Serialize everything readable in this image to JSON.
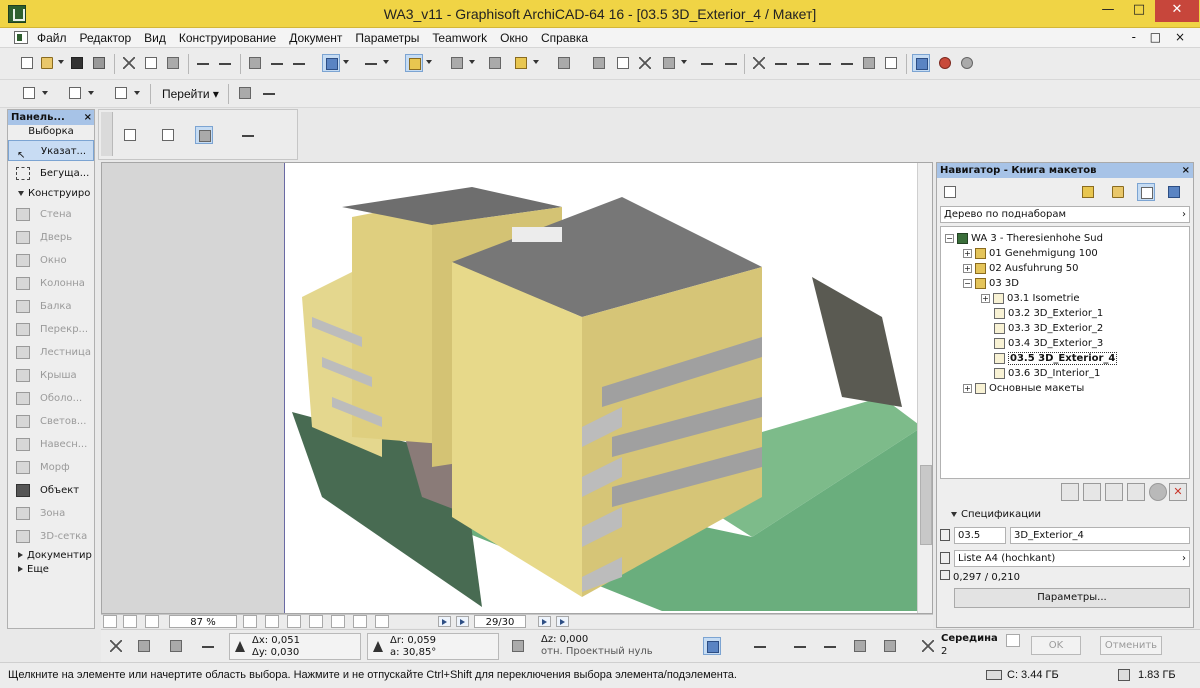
{
  "title": "WA3_v11 - Graphisoft ArchiCAD-64 16 - [03.5 3D_Exterior_4 / Макет]",
  "window_controls": {
    "minimize": "—",
    "maximize": "□",
    "close": "✕"
  },
  "doc_controls": "- □ ×",
  "menu": [
    "Файл",
    "Редактор",
    "Вид",
    "Конструирование",
    "Документ",
    "Параметры",
    "Teamwork",
    "Окно",
    "Справка"
  ],
  "toolbar": {
    "goto_label": "Перейти"
  },
  "left_panel": {
    "header": "Панель...",
    "close": "×",
    "select_title": "Выборка",
    "select_tools": [
      {
        "label": "Указат...",
        "icon": "arrow-pointer-icon",
        "active": true
      },
      {
        "label": "Бегуща...",
        "icon": "marquee-icon",
        "active": false
      }
    ],
    "design_title": "Конструиро",
    "design_tools": [
      {
        "label": "Стена",
        "icon": "wall-icon",
        "dim": true
      },
      {
        "label": "Дверь",
        "icon": "door-icon",
        "dim": true
      },
      {
        "label": "Окно",
        "icon": "window-icon",
        "dim": true
      },
      {
        "label": "Колонна",
        "icon": "column-icon",
        "dim": true
      },
      {
        "label": "Балка",
        "icon": "beam-icon",
        "dim": true
      },
      {
        "label": "Перекр...",
        "icon": "slab-icon",
        "dim": true
      },
      {
        "label": "Лестница",
        "icon": "stair-icon",
        "dim": true
      },
      {
        "label": "Крыша",
        "icon": "roof-icon",
        "dim": true
      },
      {
        "label": "Оболо...",
        "icon": "shell-icon",
        "dim": true
      },
      {
        "label": "Светов...",
        "icon": "skylight-icon",
        "dim": true
      },
      {
        "label": "Навесн...",
        "icon": "curtain-wall-icon",
        "dim": true
      },
      {
        "label": "Морф",
        "icon": "morph-icon",
        "dim": true
      },
      {
        "label": "Объект",
        "icon": "object-icon",
        "dim": false
      },
      {
        "label": "Зона",
        "icon": "zone-icon",
        "dim": true
      },
      {
        "label": "3D-сетка",
        "icon": "mesh-icon",
        "dim": true
      }
    ],
    "doc_title": "Документир",
    "more_title": "Еще"
  },
  "bottom_bar": {
    "zoom": "87 %",
    "page": "29/30"
  },
  "navigator": {
    "header": "Навигатор - Книга макетов",
    "close": "×",
    "view_mode": "Дерево по поднаборам",
    "tree": [
      {
        "label": "WA 3 - Theresienhohe Sud",
        "level": 0,
        "exp": "−",
        "icon": "root"
      },
      {
        "label": "01 Genehmigung 100",
        "level": 1,
        "exp": "+",
        "icon": "folder"
      },
      {
        "label": "02 Ausfuhrung 50",
        "level": 1,
        "exp": "+",
        "icon": "folder"
      },
      {
        "label": "03 3D",
        "level": 1,
        "exp": "−",
        "icon": "folder"
      },
      {
        "label": "03.1 Isometrie",
        "level": 2,
        "exp": "+",
        "icon": "layout"
      },
      {
        "label": "03.2 3D_Exterior_1",
        "level": 2,
        "exp": "",
        "icon": "layout"
      },
      {
        "label": "03.3 3D_Exterior_2",
        "level": 2,
        "exp": "",
        "icon": "layout"
      },
      {
        "label": "03.4 3D_Exterior_3",
        "level": 2,
        "exp": "",
        "icon": "layout"
      },
      {
        "label": "03.5 3D_Exterior_4",
        "level": 2,
        "exp": "",
        "icon": "layout",
        "selected": true
      },
      {
        "label": "03.6 3D_Interior_1",
        "level": 2,
        "exp": "",
        "icon": "layout"
      },
      {
        "label": "Основные макеты",
        "level": 1,
        "exp": "+",
        "icon": "layout"
      }
    ],
    "specs_title": "Спецификации",
    "spec_id": "03.5",
    "spec_name": "3D_Exterior_4",
    "spec_format": "Liste A4 (hochkant)",
    "spec_size": "0,297 / 0,210",
    "params_button": "Параметры..."
  },
  "info_bar": {
    "dx": "Δx: 0,051",
    "dy": "Δy: 0,030",
    "dr": "Δr: 0,059",
    "angle": "a: 30,85°",
    "dz": "Δz: 0,000",
    "ref": "отн. Проектный нуль",
    "snap_title": "Середина",
    "snap_value": "2",
    "ok": "OK",
    "cancel": "Отменить"
  },
  "status": {
    "message": "Щелкните на элементе или начертите область выбора. Нажмите и не отпускайте Ctrl+Shift для переключения выбора элемента/подэлемента.",
    "disk": "С: 3.44 ГБ",
    "memory": "1.83 ГБ"
  },
  "colors": {
    "accent_title": "#f0d445",
    "panel_header": "#a7c3e7",
    "facade": "#e8d98a",
    "roof": "#777777",
    "grass": "#6aae7d"
  }
}
